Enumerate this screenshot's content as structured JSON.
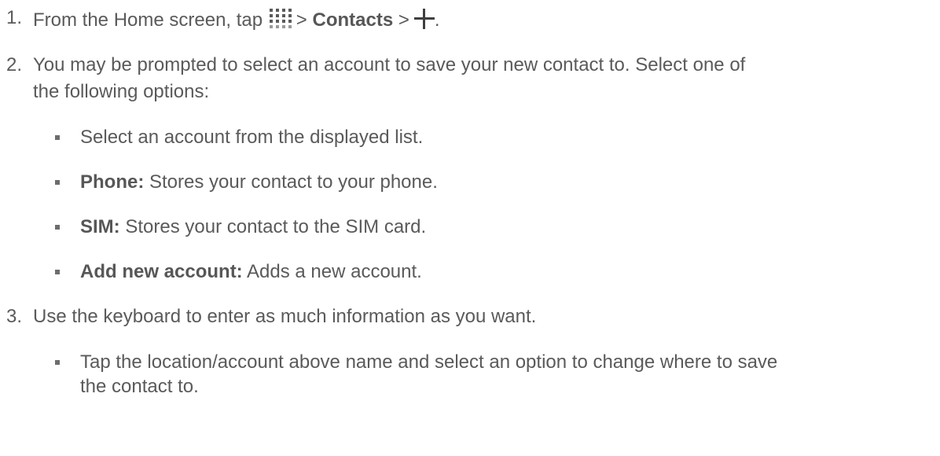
{
  "steps": [
    {
      "num": "1.",
      "pre": "From the Home screen, tap",
      "icon": "apps-grid-icon",
      "sep1": ">",
      "bold": "Contacts",
      "sep2": ">",
      "icon2": "add-plus-icon",
      "post": "."
    },
    {
      "num": "2.",
      "line1": "You may be prompted to select an account to save your new contact to. Select one of",
      "line2": "the following options:",
      "bullets": [
        {
          "bold": "",
          "text": "Select an account from the displayed list."
        },
        {
          "bold": "Phone:",
          "text": "Stores your contact to your phone."
        },
        {
          "bold": "SIM:",
          "text": "Stores your contact to the SIM card."
        },
        {
          "bold": "Add new account:",
          "text": "Adds a new account."
        }
      ]
    },
    {
      "num": "3.",
      "line1": "Use the keyboard to enter as much information as you want.",
      "bullets": [
        {
          "line1": "Tap the location/account above name and select an option to change where to save",
          "line2": "the contact to."
        }
      ]
    }
  ]
}
